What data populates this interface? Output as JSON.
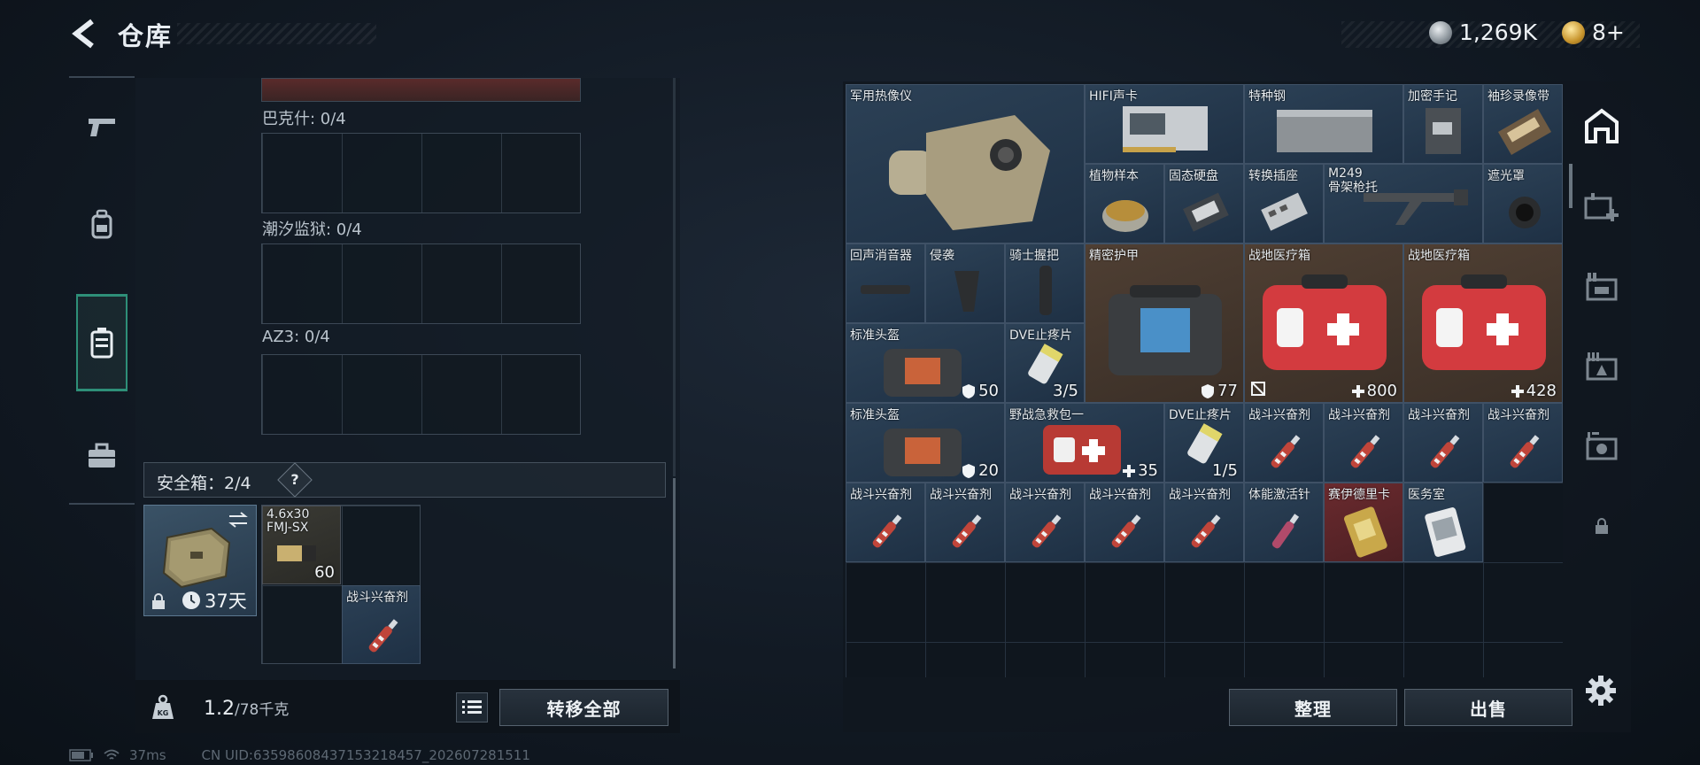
{
  "header": {
    "title": "仓库",
    "currency_silver": "1,269K",
    "currency_gold": "8+"
  },
  "left_nav": [
    "pistol-icon",
    "backpack-icon",
    "safe-container-icon",
    "briefcase-icon"
  ],
  "storage": {
    "bags": [
      {
        "label": "巴克什: 0/4"
      },
      {
        "label": "潮汐监狱: 0/4"
      },
      {
        "label": "AZ3: 0/4"
      }
    ],
    "safebox_title": "安全箱：2/4",
    "help": "?",
    "safebox_days": "37天",
    "safe_items": [
      {
        "name": "4.6x30 FMJ-SX",
        "count": "60"
      },
      {
        "name": "战斗兴奋剂",
        "count": ""
      }
    ]
  },
  "bottom_bar": {
    "weight_icon_text": "KG",
    "weight_current": "1.2",
    "weight_max": "/78千克",
    "transfer_all": "转移全部"
  },
  "status": {
    "ping": "37ms",
    "uid": "CN UID:635986084371532184​57_202607281511"
  },
  "inventory": {
    "items": [
      {
        "name": "军用热像仪",
        "badge": ""
      },
      {
        "name": "HIFI声卡",
        "badge": ""
      },
      {
        "name": "特种钢",
        "badge": ""
      },
      {
        "name": "加密手记",
        "badge": ""
      },
      {
        "name": "袖珍录像带",
        "badge": ""
      },
      {
        "name": "植物样本",
        "badge": ""
      },
      {
        "name": "固态硬盘",
        "badge": ""
      },
      {
        "name": "转换插座",
        "badge": ""
      },
      {
        "name": "M249\n骨架枪托",
        "badge": ""
      },
      {
        "name": "遮光罩",
        "badge": ""
      },
      {
        "name": "回声消音器",
        "badge": ""
      },
      {
        "name": "侵袭",
        "badge": ""
      },
      {
        "name": "骑士握把",
        "badge": ""
      },
      {
        "name": "精密护甲",
        "badge": "77"
      },
      {
        "name": "战地医疗箱",
        "badge": "800"
      },
      {
        "name": "战地医疗箱",
        "badge": "428"
      },
      {
        "name": "标准头盔",
        "badge": "50"
      },
      {
        "name": "DVE止疼片",
        "badge": "3/5"
      },
      {
        "name": "标准头盔",
        "badge": "20"
      },
      {
        "name": "野战急救包一",
        "badge": "35"
      },
      {
        "name": "DVE止疼片",
        "badge": "1/5"
      },
      {
        "name": "战斗兴奋剂",
        "badge": ""
      },
      {
        "name": "战斗兴奋剂",
        "badge": ""
      },
      {
        "name": "战斗兴奋剂",
        "badge": ""
      },
      {
        "name": "战斗兴奋剂",
        "badge": ""
      },
      {
        "name": "战斗兴奋剂",
        "badge": ""
      },
      {
        "name": "战斗兴奋剂",
        "badge": ""
      },
      {
        "name": "战斗兴奋剂",
        "badge": ""
      },
      {
        "name": "战斗兴奋剂",
        "badge": ""
      },
      {
        "name": "战斗兴奋剂",
        "badge": ""
      },
      {
        "name": "体能激活针",
        "badge": ""
      },
      {
        "name": "赛伊德里卡",
        "badge": ""
      },
      {
        "name": "医务室",
        "badge": ""
      }
    ],
    "sort_label": "整理",
    "sell_label": "出售"
  },
  "right_nav": [
    "shelter-icon",
    "medical-plus-icon",
    "storage-2-icon",
    "storage-3-icon",
    "storage-4-icon",
    "lock-icon"
  ],
  "colors": {
    "accent_teal": "#2e8f78",
    "rarity_blue": "#2c4156",
    "rarity_gold": "#4f3f33",
    "rarity_red": "#6a2a2e"
  }
}
